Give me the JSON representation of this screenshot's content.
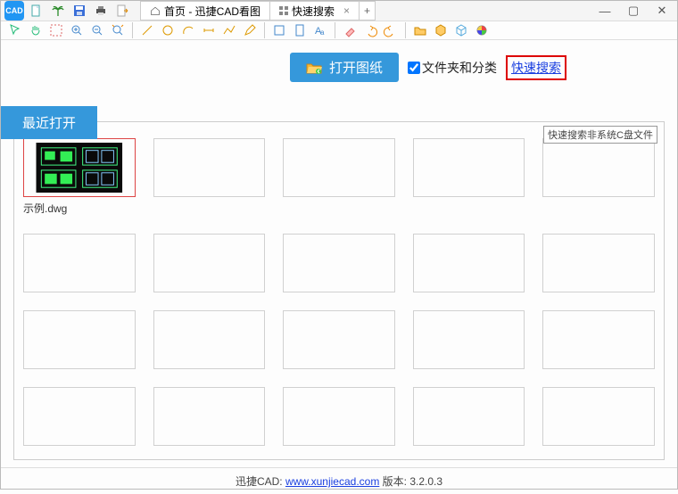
{
  "titlebar": {
    "tabs": [
      {
        "label": "首页 - 迅捷CAD看图"
      },
      {
        "label": "快速搜索"
      }
    ]
  },
  "action": {
    "open_label": "打开图纸",
    "folders_label": "文件夹和分类",
    "quick_search_label": "快速搜索",
    "tooltip": "快速搜索非系统C盘文件"
  },
  "recent": {
    "tab_label": "最近打开",
    "example_file": "示例.dwg"
  },
  "footer": {
    "prefix": "迅捷CAD: ",
    "url": "www.xunjiecad.com",
    "version_prefix": " 版本: ",
    "version": "3.2.0.3"
  }
}
